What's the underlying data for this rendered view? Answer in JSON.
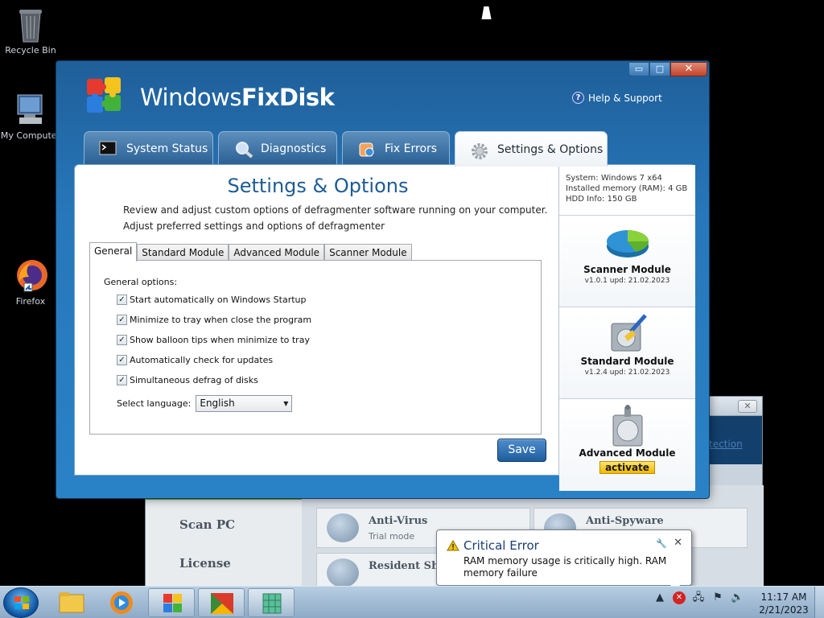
{
  "desktop": {
    "icons": [
      {
        "label": "Recycle Bin",
        "icon": "recycle-bin-icon"
      },
      {
        "label": "My Computer",
        "icon": "computer-icon"
      },
      {
        "label": "Firefox",
        "icon": "firefox-icon"
      }
    ]
  },
  "background_app": {
    "header_link": "tection",
    "sidebar": [
      "Scan PC",
      "License"
    ],
    "cards": [
      {
        "title": "Anti-Virus",
        "status": "Trial mode"
      },
      {
        "title": "Anti-Spyware",
        "status": ""
      },
      {
        "title": "Resident Shie",
        "status": ""
      }
    ]
  },
  "app": {
    "brand_regular": "Windows",
    "brand_bold": "FixDisk",
    "help_label": "Help & Support",
    "window_buttons": {
      "minimize": "▭",
      "maximize": "□",
      "close": "✕"
    },
    "tabs": [
      {
        "label": "System Status",
        "icon": "terminal-icon",
        "active": false
      },
      {
        "label": "Diagnostics",
        "icon": "magnifier-icon",
        "active": false
      },
      {
        "label": "Fix Errors",
        "icon": "fix-errors-icon",
        "active": false
      },
      {
        "label": "Settings & Options",
        "icon": "gear-icon",
        "active": true
      }
    ],
    "content": {
      "title": "Settings & Options",
      "desc_line1": "Review and adjust custom options of defragmenter software running on your computer.",
      "desc_line2": "Adjust preferred settings and options of defragmenter",
      "inner_tabs": [
        "General",
        "Standard Module",
        "Advanced Module",
        "Scanner Module"
      ],
      "active_inner_tab": "General",
      "group_label": "General options:",
      "options": [
        {
          "label": "Start automatically on Windows Startup",
          "checked": true
        },
        {
          "label": "Minimize to tray when close the program",
          "checked": true
        },
        {
          "label": "Show balloon tips when minimize to tray",
          "checked": true
        },
        {
          "label": "Automatically check for updates",
          "checked": true
        },
        {
          "label": "Simultaneous defrag of disks",
          "checked": true
        }
      ],
      "language_label": "Select language:",
      "language_value": "English",
      "save_label": "Save"
    },
    "sysinfo": {
      "system": "System: Windows 7 x64",
      "memory": "Installed memory (RAM): 4 GB",
      "hdd": "HDD Info: 150 GB"
    },
    "modules": [
      {
        "name": "Scanner Module",
        "version": "v1.0.1 upd: 21.02.2023",
        "icon": "pie-chart-icon"
      },
      {
        "name": "Standard Module",
        "version": "v1.2.4 upd: 21.02.2023",
        "icon": "disk-brush-icon"
      },
      {
        "name": "Advanced Module",
        "action": "activate",
        "icon": "disk-icon"
      }
    ]
  },
  "balloon": {
    "title": "Critical Error",
    "message": "RAM memory usage is critically high. RAM memory failure"
  },
  "taskbar": {
    "time": "11:17 AM",
    "date": "2/21/2023"
  },
  "colors": {
    "app_blue": "#2777ba",
    "title_blue": "#1e5c94",
    "save_button": "#2a6bb0",
    "activate_yellow": "#f5c400",
    "error_red": "#d42323"
  }
}
